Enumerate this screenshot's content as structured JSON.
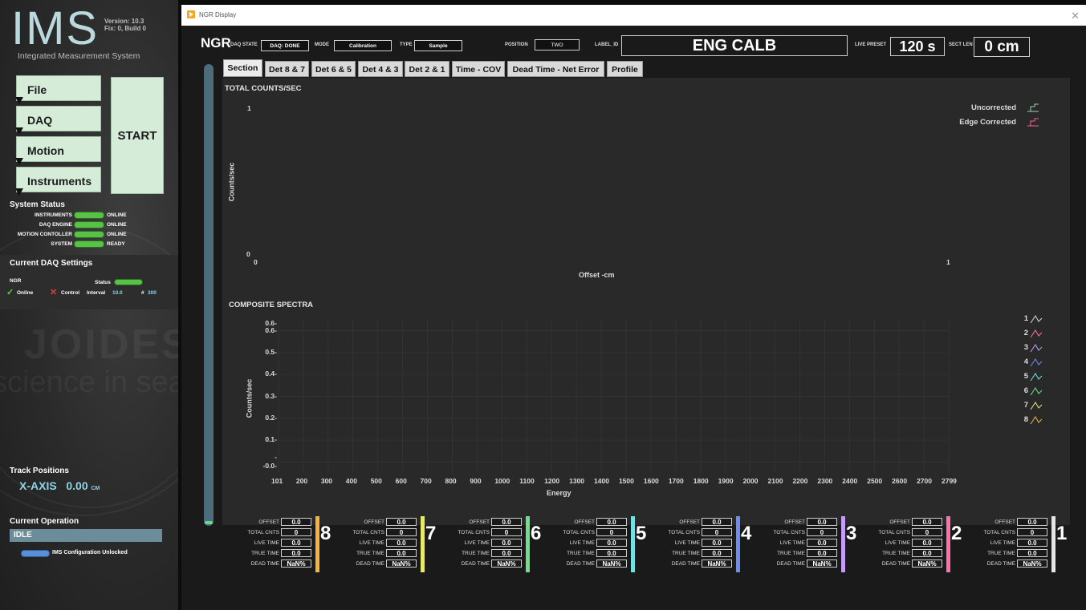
{
  "left": {
    "logo": "IMS",
    "version_line1": "Version: 10.3",
    "version_line2": "Fix: 0, Build 0",
    "subtitle": "Integrated Measurement System",
    "menu": [
      {
        "label": "File"
      },
      {
        "label": "DAQ"
      },
      {
        "label": "Motion"
      },
      {
        "label": "Instruments"
      }
    ],
    "start_label": "START",
    "system_status_title": "System Status",
    "system_status": [
      {
        "label": "INSTRUMENTS",
        "value": "ONLINE"
      },
      {
        "label": "DAQ ENGINE",
        "value": "ONLINE"
      },
      {
        "label": "MOTION CONTOLLER",
        "value": "ONLINE"
      },
      {
        "label": "SYSTEM",
        "value": "READY"
      }
    ],
    "daq_settings_title": "Current DAQ Settings",
    "daq": {
      "name": "NGR",
      "status_label": "Status",
      "online_label": "Online",
      "control_label": "Control",
      "interval_label": "Interval",
      "interval_value": "10.0",
      "count_label": "#",
      "count_value": "300"
    },
    "watermark_1": "JOIDES",
    "watermark_2": "science in sea",
    "track_title": "Track Positions",
    "xaxis_label": "X-AXIS",
    "xaxis_value": "0.00",
    "xaxis_unit": "CM",
    "operation_title": "Current Operation",
    "operation_value": "IDLE",
    "config_status": "IMS Configuration Unlocked"
  },
  "window": {
    "title": "NGR Display",
    "close": "✕"
  },
  "header": {
    "name": "NGR",
    "daq_state_label": "DAQ STATE",
    "daq_state_value": "DAQ: DONE",
    "mode_label": "MODE",
    "mode_value": "Calibration",
    "type_label": "TYPE",
    "type_value": "Sample",
    "position_label": "POSITION",
    "position_value": "TWO",
    "label_id_label": "LABEL_ID",
    "label_id_value": "ENG CALB",
    "live_preset_label": "LIVE PRESET",
    "live_preset_value": "120 s",
    "sect_len_label": "SECT LEN",
    "sect_len_value": "0 cm"
  },
  "tabs": [
    "Section",
    "Det 8 & 7",
    "Det 6 & 5",
    "Det 4 & 3",
    "Det 2 & 1",
    "Time - COV",
    "Dead Time - Net Error",
    "Profile"
  ],
  "counts_chart": {
    "title": "TOTAL COUNTS/SEC",
    "ylabel": "Counts/sec",
    "xlabel": "Offset -cm",
    "y_top": "1",
    "y_bottom": "0",
    "x_left": "0",
    "x_right": "1",
    "legend": [
      {
        "label": "Uncorrected",
        "color": "#9fd0b0"
      },
      {
        "label": "Edge Corrected",
        "color": "#ff5a9a"
      }
    ]
  },
  "chart_data": {
    "type": "line",
    "title": "COMPOSITE SPECTRA",
    "xlabel": "Energy",
    "ylabel": "Counts/sec",
    "xlim": [
      101,
      2799
    ],
    "ylim": [
      -0.05,
      0.65
    ],
    "x_ticks": [
      "101",
      "200",
      "300",
      "400",
      "500",
      "600",
      "700",
      "800",
      "900",
      "1000",
      "1100",
      "1200",
      "1300",
      "1400",
      "1500",
      "1600",
      "1700",
      "1800",
      "1900",
      "2000",
      "2100",
      "2200",
      "2300",
      "2400",
      "2500",
      "2600",
      "2700",
      "2799"
    ],
    "y_ticks": [
      "0.6-",
      "0.6-",
      "0.5-",
      "0.4-",
      "0.3-",
      "0.2-",
      "0.1-",
      "-",
      "-0.0-"
    ],
    "series": [
      {
        "name": "1",
        "color": "#d9d9d9",
        "values": []
      },
      {
        "name": "2",
        "color": "#ff6fa8",
        "values": []
      },
      {
        "name": "3",
        "color": "#c69cf5",
        "values": []
      },
      {
        "name": "4",
        "color": "#6f8cf5",
        "values": []
      },
      {
        "name": "5",
        "color": "#76e0e0",
        "values": []
      },
      {
        "name": "6",
        "color": "#6fe08a",
        "values": []
      },
      {
        "name": "7",
        "color": "#e8e86a",
        "values": []
      },
      {
        "name": "8",
        "color": "#f5b23c",
        "values": []
      }
    ]
  },
  "detectors": [
    {
      "num": "8",
      "color": "#f5b23c",
      "offset": "0.0",
      "total": "0",
      "live": "0.0",
      "true": "0.0",
      "dead": "NaN%"
    },
    {
      "num": "7",
      "color": "#e8e86a",
      "offset": "0.0",
      "total": "0",
      "live": "0.0",
      "true": "0.0",
      "dead": "NaN%"
    },
    {
      "num": "6",
      "color": "#6fe08a",
      "offset": "0.0",
      "total": "0",
      "live": "0.0",
      "true": "0.0",
      "dead": "NaN%"
    },
    {
      "num": "5",
      "color": "#76e0e0",
      "offset": "0.0",
      "total": "0",
      "live": "0.0",
      "true": "0.0",
      "dead": "NaN%"
    },
    {
      "num": "4",
      "color": "#6f8cf5",
      "offset": "0.0",
      "total": "0",
      "live": "0.0",
      "true": "0.0",
      "dead": "NaN%"
    },
    {
      "num": "3",
      "color": "#c69cf5",
      "offset": "0.0",
      "total": "0",
      "live": "0.0",
      "true": "0.0",
      "dead": "NaN%"
    },
    {
      "num": "2",
      "color": "#ff6fa8",
      "offset": "0.0",
      "total": "0",
      "live": "0.0",
      "true": "0.0",
      "dead": "NaN%"
    },
    {
      "num": "1",
      "color": "#e6e6e6",
      "offset": "0.0",
      "total": "0",
      "live": "0.0",
      "true": "0.0",
      "dead": "NaN%"
    }
  ],
  "det_labels": {
    "offset": "OFFSET",
    "total": "TOTAL CNTS",
    "live": "LIVE TIME",
    "true": "TRUE TIME",
    "dead": "DEAD TIME"
  }
}
